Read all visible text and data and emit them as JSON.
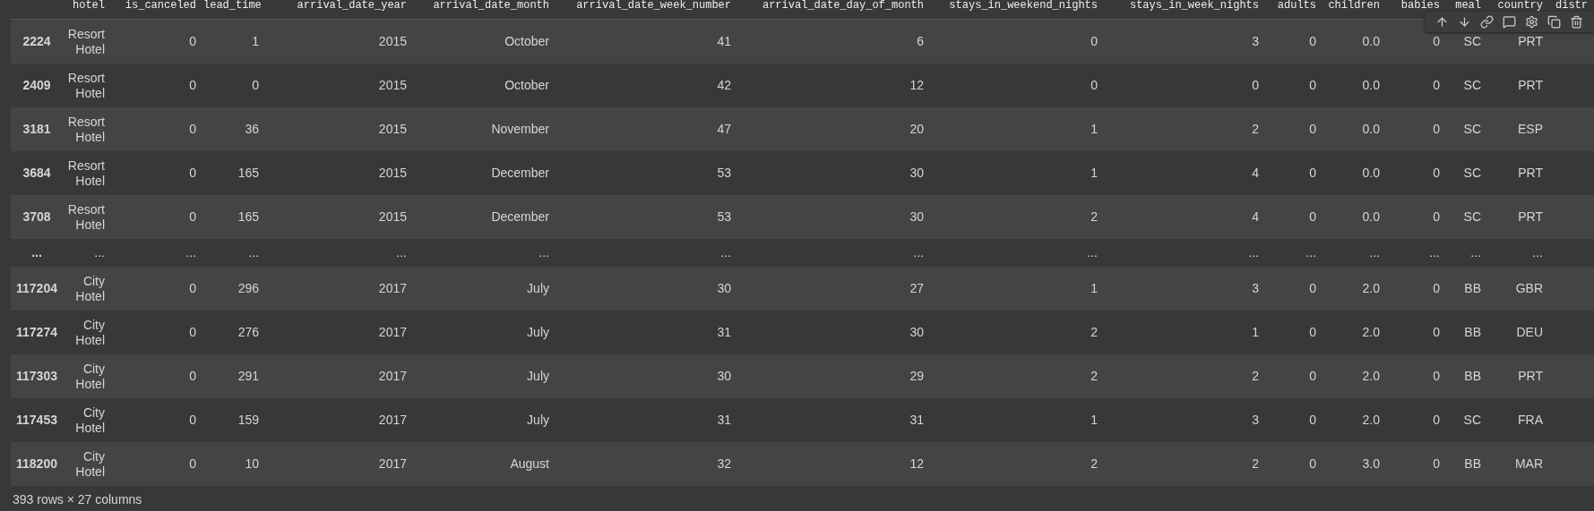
{
  "columns": [
    "",
    "hotel",
    "is_canceled",
    "lead_time",
    "arrival_date_year",
    "arrival_date_month",
    "arrival_date_week_number",
    "arrival_date_day_of_month",
    "stays_in_weekend_nights",
    "stays_in_week_nights",
    "adults",
    "children",
    "babies",
    "meal",
    "country",
    "distr"
  ],
  "rows": [
    {
      "kind": "data",
      "index": "2224",
      "cells": [
        "Resort Hotel",
        "0",
        "1",
        "2015",
        "October",
        "41",
        "6",
        "0",
        "3",
        "0",
        "0.0",
        "0",
        "SC",
        "PRT"
      ]
    },
    {
      "kind": "data",
      "index": "2409",
      "cells": [
        "Resort Hotel",
        "0",
        "0",
        "2015",
        "October",
        "42",
        "12",
        "0",
        "0",
        "0",
        "0.0",
        "0",
        "SC",
        "PRT"
      ]
    },
    {
      "kind": "data",
      "index": "3181",
      "cells": [
        "Resort Hotel",
        "0",
        "36",
        "2015",
        "November",
        "47",
        "20",
        "1",
        "2",
        "0",
        "0.0",
        "0",
        "SC",
        "ESP"
      ]
    },
    {
      "kind": "data",
      "index": "3684",
      "cells": [
        "Resort Hotel",
        "0",
        "165",
        "2015",
        "December",
        "53",
        "30",
        "1",
        "4",
        "0",
        "0.0",
        "0",
        "SC",
        "PRT"
      ]
    },
    {
      "kind": "data",
      "index": "3708",
      "cells": [
        "Resort Hotel",
        "0",
        "165",
        "2015",
        "December",
        "53",
        "30",
        "2",
        "4",
        "0",
        "0.0",
        "0",
        "SC",
        "PRT"
      ]
    },
    {
      "kind": "ellipsis",
      "index": "...",
      "cells": [
        "...",
        "...",
        "...",
        "...",
        "...",
        "...",
        "...",
        "...",
        "...",
        "...",
        "...",
        "...",
        "...",
        "..."
      ]
    },
    {
      "kind": "data",
      "index": "117204",
      "cells": [
        "City Hotel",
        "0",
        "296",
        "2017",
        "July",
        "30",
        "27",
        "1",
        "3",
        "0",
        "2.0",
        "0",
        "BB",
        "GBR"
      ]
    },
    {
      "kind": "data",
      "index": "117274",
      "cells": [
        "City Hotel",
        "0",
        "276",
        "2017",
        "July",
        "31",
        "30",
        "2",
        "1",
        "0",
        "2.0",
        "0",
        "BB",
        "DEU"
      ]
    },
    {
      "kind": "data",
      "index": "117303",
      "cells": [
        "City Hotel",
        "0",
        "291",
        "2017",
        "July",
        "30",
        "29",
        "2",
        "2",
        "0",
        "2.0",
        "0",
        "BB",
        "PRT"
      ]
    },
    {
      "kind": "data",
      "index": "117453",
      "cells": [
        "City Hotel",
        "0",
        "159",
        "2017",
        "July",
        "31",
        "31",
        "1",
        "3",
        "0",
        "2.0",
        "0",
        "SC",
        "FRA"
      ]
    },
    {
      "kind": "data",
      "index": "118200",
      "cells": [
        "City Hotel",
        "0",
        "10",
        "2017",
        "August",
        "32",
        "12",
        "2",
        "2",
        "0",
        "3.0",
        "0",
        "BB",
        "MAR"
      ]
    }
  ],
  "footer": "393 rows × 27 columns"
}
